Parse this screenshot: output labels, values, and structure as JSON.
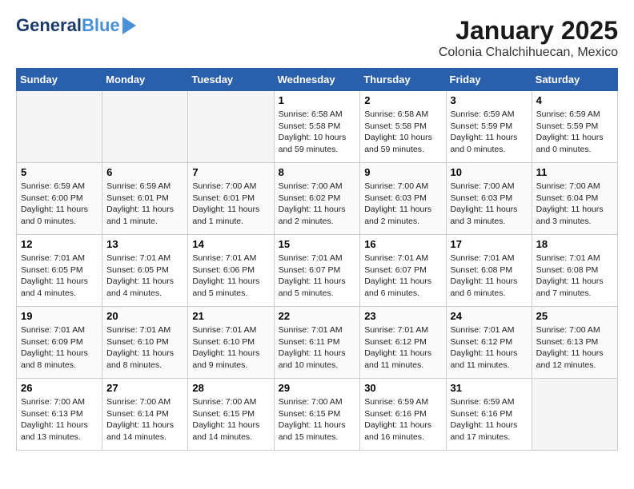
{
  "header": {
    "logo_line1": "General",
    "logo_line2": "Blue",
    "month_title": "January 2025",
    "subtitle": "Colonia Chalchihuecan, Mexico"
  },
  "weekdays": [
    "Sunday",
    "Monday",
    "Tuesday",
    "Wednesday",
    "Thursday",
    "Friday",
    "Saturday"
  ],
  "weeks": [
    [
      {
        "day": "",
        "content": ""
      },
      {
        "day": "",
        "content": ""
      },
      {
        "day": "",
        "content": ""
      },
      {
        "day": "1",
        "content": "Sunrise: 6:58 AM\nSunset: 5:58 PM\nDaylight: 10 hours and 59 minutes."
      },
      {
        "day": "2",
        "content": "Sunrise: 6:58 AM\nSunset: 5:58 PM\nDaylight: 10 hours and 59 minutes."
      },
      {
        "day": "3",
        "content": "Sunrise: 6:59 AM\nSunset: 5:59 PM\nDaylight: 11 hours and 0 minutes."
      },
      {
        "day": "4",
        "content": "Sunrise: 6:59 AM\nSunset: 5:59 PM\nDaylight: 11 hours and 0 minutes."
      }
    ],
    [
      {
        "day": "5",
        "content": "Sunrise: 6:59 AM\nSunset: 6:00 PM\nDaylight: 11 hours and 0 minutes."
      },
      {
        "day": "6",
        "content": "Sunrise: 6:59 AM\nSunset: 6:01 PM\nDaylight: 11 hours and 1 minute."
      },
      {
        "day": "7",
        "content": "Sunrise: 7:00 AM\nSunset: 6:01 PM\nDaylight: 11 hours and 1 minute."
      },
      {
        "day": "8",
        "content": "Sunrise: 7:00 AM\nSunset: 6:02 PM\nDaylight: 11 hours and 2 minutes."
      },
      {
        "day": "9",
        "content": "Sunrise: 7:00 AM\nSunset: 6:03 PM\nDaylight: 11 hours and 2 minutes."
      },
      {
        "day": "10",
        "content": "Sunrise: 7:00 AM\nSunset: 6:03 PM\nDaylight: 11 hours and 3 minutes."
      },
      {
        "day": "11",
        "content": "Sunrise: 7:00 AM\nSunset: 6:04 PM\nDaylight: 11 hours and 3 minutes."
      }
    ],
    [
      {
        "day": "12",
        "content": "Sunrise: 7:01 AM\nSunset: 6:05 PM\nDaylight: 11 hours and 4 minutes."
      },
      {
        "day": "13",
        "content": "Sunrise: 7:01 AM\nSunset: 6:05 PM\nDaylight: 11 hours and 4 minutes."
      },
      {
        "day": "14",
        "content": "Sunrise: 7:01 AM\nSunset: 6:06 PM\nDaylight: 11 hours and 5 minutes."
      },
      {
        "day": "15",
        "content": "Sunrise: 7:01 AM\nSunset: 6:07 PM\nDaylight: 11 hours and 5 minutes."
      },
      {
        "day": "16",
        "content": "Sunrise: 7:01 AM\nSunset: 6:07 PM\nDaylight: 11 hours and 6 minutes."
      },
      {
        "day": "17",
        "content": "Sunrise: 7:01 AM\nSunset: 6:08 PM\nDaylight: 11 hours and 6 minutes."
      },
      {
        "day": "18",
        "content": "Sunrise: 7:01 AM\nSunset: 6:08 PM\nDaylight: 11 hours and 7 minutes."
      }
    ],
    [
      {
        "day": "19",
        "content": "Sunrise: 7:01 AM\nSunset: 6:09 PM\nDaylight: 11 hours and 8 minutes."
      },
      {
        "day": "20",
        "content": "Sunrise: 7:01 AM\nSunset: 6:10 PM\nDaylight: 11 hours and 8 minutes."
      },
      {
        "day": "21",
        "content": "Sunrise: 7:01 AM\nSunset: 6:10 PM\nDaylight: 11 hours and 9 minutes."
      },
      {
        "day": "22",
        "content": "Sunrise: 7:01 AM\nSunset: 6:11 PM\nDaylight: 11 hours and 10 minutes."
      },
      {
        "day": "23",
        "content": "Sunrise: 7:01 AM\nSunset: 6:12 PM\nDaylight: 11 hours and 11 minutes."
      },
      {
        "day": "24",
        "content": "Sunrise: 7:01 AM\nSunset: 6:12 PM\nDaylight: 11 hours and 11 minutes."
      },
      {
        "day": "25",
        "content": "Sunrise: 7:00 AM\nSunset: 6:13 PM\nDaylight: 11 hours and 12 minutes."
      }
    ],
    [
      {
        "day": "26",
        "content": "Sunrise: 7:00 AM\nSunset: 6:13 PM\nDaylight: 11 hours and 13 minutes."
      },
      {
        "day": "27",
        "content": "Sunrise: 7:00 AM\nSunset: 6:14 PM\nDaylight: 11 hours and 14 minutes."
      },
      {
        "day": "28",
        "content": "Sunrise: 7:00 AM\nSunset: 6:15 PM\nDaylight: 11 hours and 14 minutes."
      },
      {
        "day": "29",
        "content": "Sunrise: 7:00 AM\nSunset: 6:15 PM\nDaylight: 11 hours and 15 minutes."
      },
      {
        "day": "30",
        "content": "Sunrise: 6:59 AM\nSunset: 6:16 PM\nDaylight: 11 hours and 16 minutes."
      },
      {
        "day": "31",
        "content": "Sunrise: 6:59 AM\nSunset: 6:16 PM\nDaylight: 11 hours and 17 minutes."
      },
      {
        "day": "",
        "content": ""
      }
    ]
  ]
}
